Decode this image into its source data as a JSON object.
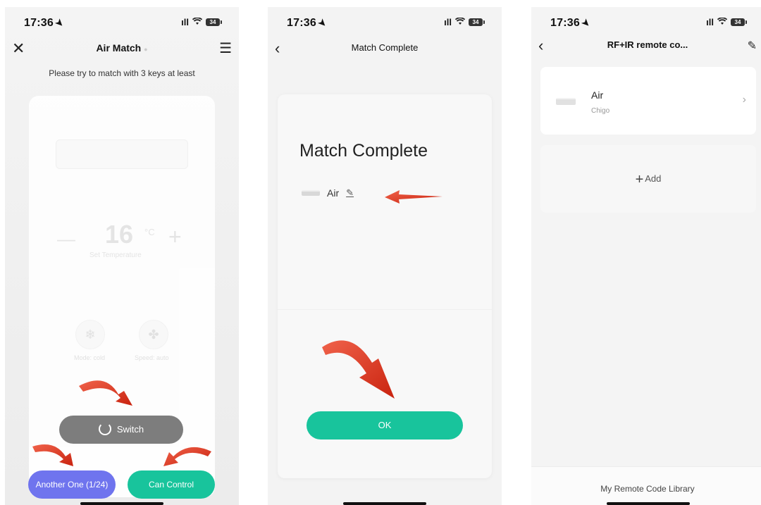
{
  "status": {
    "time": "17:36",
    "battery": "34"
  },
  "screen1": {
    "title": "Air Match",
    "hint": "Please try to match with 3 keys at least",
    "temperature": "16",
    "unit": "°C",
    "set_temp_label": "Set Temperature",
    "mode_label": "Mode: cold",
    "speed_label": "Speed: auto",
    "switch_label": "Switch",
    "another_label": "Another One (1/24)",
    "can_control_label": "Can Control"
  },
  "screen2": {
    "title": "Match Complete",
    "heading": "Match Complete",
    "device_name": "Air",
    "ok_label": "OK"
  },
  "screen3": {
    "title": "RF+IR remote co...",
    "device_name": "Air",
    "device_brand": "Chigo",
    "add_label": "Add",
    "library_label": "My Remote Code Library"
  },
  "colors": {
    "accent_green": "#18c49c",
    "accent_purple": "#6f74ee",
    "switch_gray": "#7d7d7d",
    "annotation_arrow": "#e0321c"
  },
  "icons": [
    "close-icon",
    "menu-icon",
    "back-icon",
    "edit-icon",
    "power-icon",
    "snowflake-icon",
    "fan-icon",
    "chevron-right-icon",
    "plus-icon",
    "location-arrow-icon",
    "signal-icon",
    "wifi-icon",
    "battery-icon"
  ]
}
